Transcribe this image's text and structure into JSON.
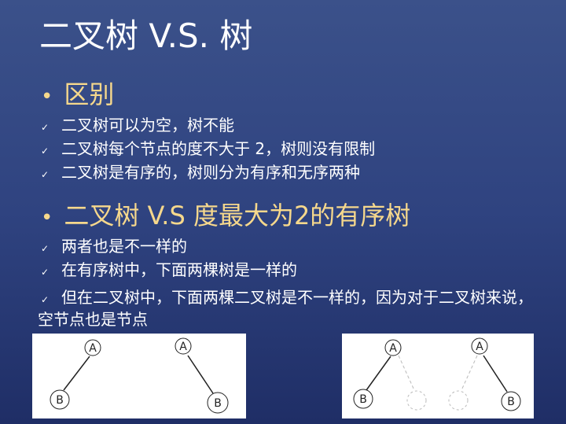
{
  "title": "二叉树 V.S. 树",
  "section1": {
    "heading": "区别",
    "items": [
      "二叉树可以为空，树不能",
      "二叉树每个节点的度不大于 2，树则没有限制",
      "二叉树是有序的，树则分为有序和无序两种"
    ]
  },
  "section2": {
    "heading": "二叉树 V.S 度最大为2的有序树",
    "items": [
      "两者也是不一样的",
      "在有序树中，下面两棵树是一样的",
      "但在二叉树中，下面两棵二叉树是不一样的，因为对于二叉树来说，空节点也是节点"
    ]
  },
  "diagrams": {
    "node_labels": [
      "A",
      "B"
    ]
  },
  "colors": {
    "heading": "#f6d88c",
    "bg_top": "#3b518a",
    "bg_bottom": "#1f2e66"
  }
}
